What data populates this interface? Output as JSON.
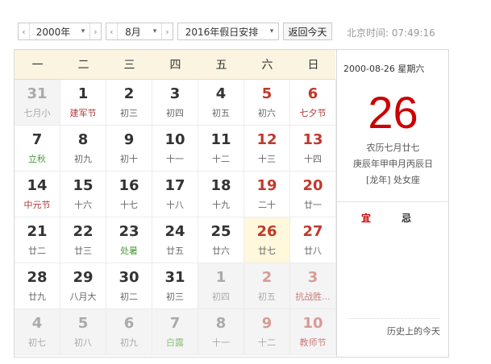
{
  "toolbar": {
    "year_label": "2000年",
    "month_label": "8月",
    "holiday_label": "2016年假日安排",
    "today_button": "返回今天",
    "time_text": "北京时间: 07:49:16"
  },
  "weekdays": [
    "一",
    "二",
    "三",
    "四",
    "五",
    "六",
    "日"
  ],
  "days": [
    {
      "n": "31",
      "l": "七月小",
      "other": true,
      "we": false,
      "c": ""
    },
    {
      "n": "1",
      "l": "建军节",
      "other": false,
      "we": false,
      "c": "hol"
    },
    {
      "n": "2",
      "l": "初三",
      "other": false,
      "we": false,
      "c": ""
    },
    {
      "n": "3",
      "l": "初四",
      "other": false,
      "we": false,
      "c": ""
    },
    {
      "n": "4",
      "l": "初五",
      "other": false,
      "we": false,
      "c": ""
    },
    {
      "n": "5",
      "l": "初六",
      "other": false,
      "we": true,
      "c": ""
    },
    {
      "n": "6",
      "l": "七夕节",
      "other": false,
      "we": true,
      "c": "hol"
    },
    {
      "n": "7",
      "l": "立秋",
      "other": false,
      "we": false,
      "c": "term"
    },
    {
      "n": "8",
      "l": "初九",
      "other": false,
      "we": false,
      "c": ""
    },
    {
      "n": "9",
      "l": "初十",
      "other": false,
      "we": false,
      "c": ""
    },
    {
      "n": "10",
      "l": "十一",
      "other": false,
      "we": false,
      "c": ""
    },
    {
      "n": "11",
      "l": "十二",
      "other": false,
      "we": false,
      "c": ""
    },
    {
      "n": "12",
      "l": "十三",
      "other": false,
      "we": true,
      "c": ""
    },
    {
      "n": "13",
      "l": "十四",
      "other": false,
      "we": true,
      "c": ""
    },
    {
      "n": "14",
      "l": "中元节",
      "other": false,
      "we": false,
      "c": "hol"
    },
    {
      "n": "15",
      "l": "十六",
      "other": false,
      "we": false,
      "c": ""
    },
    {
      "n": "16",
      "l": "十七",
      "other": false,
      "we": false,
      "c": ""
    },
    {
      "n": "17",
      "l": "十八",
      "other": false,
      "we": false,
      "c": ""
    },
    {
      "n": "18",
      "l": "十九",
      "other": false,
      "we": false,
      "c": ""
    },
    {
      "n": "19",
      "l": "二十",
      "other": false,
      "we": true,
      "c": ""
    },
    {
      "n": "20",
      "l": "廿一",
      "other": false,
      "we": true,
      "c": ""
    },
    {
      "n": "21",
      "l": "廿二",
      "other": false,
      "we": false,
      "c": ""
    },
    {
      "n": "22",
      "l": "廿三",
      "other": false,
      "we": false,
      "c": ""
    },
    {
      "n": "23",
      "l": "处暑",
      "other": false,
      "we": false,
      "c": "term"
    },
    {
      "n": "24",
      "l": "廿五",
      "other": false,
      "we": false,
      "c": ""
    },
    {
      "n": "25",
      "l": "廿六",
      "other": false,
      "we": false,
      "c": ""
    },
    {
      "n": "26",
      "l": "廿七",
      "other": false,
      "we": true,
      "c": "",
      "sel": true
    },
    {
      "n": "27",
      "l": "廿八",
      "other": false,
      "we": true,
      "c": ""
    },
    {
      "n": "28",
      "l": "廿九",
      "other": false,
      "we": false,
      "c": ""
    },
    {
      "n": "29",
      "l": "八月大",
      "other": false,
      "we": false,
      "c": ""
    },
    {
      "n": "30",
      "l": "初二",
      "other": false,
      "we": false,
      "c": ""
    },
    {
      "n": "31",
      "l": "初三",
      "other": false,
      "we": false,
      "c": ""
    },
    {
      "n": "1",
      "l": "初四",
      "other": true,
      "we": false,
      "c": ""
    },
    {
      "n": "2",
      "l": "初五",
      "other": true,
      "we": true,
      "c": ""
    },
    {
      "n": "3",
      "l": "抗战胜...",
      "other": true,
      "we": true,
      "c": "hol"
    },
    {
      "n": "4",
      "l": "初七",
      "other": true,
      "we": false,
      "c": ""
    },
    {
      "n": "5",
      "l": "初八",
      "other": true,
      "we": false,
      "c": ""
    },
    {
      "n": "6",
      "l": "初九",
      "other": true,
      "we": false,
      "c": ""
    },
    {
      "n": "7",
      "l": "白露",
      "other": true,
      "we": false,
      "c": "term"
    },
    {
      "n": "8",
      "l": "十一",
      "other": true,
      "we": false,
      "c": ""
    },
    {
      "n": "9",
      "l": "十二",
      "other": true,
      "we": true,
      "c": ""
    },
    {
      "n": "10",
      "l": "教师节",
      "other": true,
      "we": true,
      "c": "hol"
    }
  ],
  "side": {
    "date_line": "2000-08-26  星期六",
    "big_day": "26",
    "lunar": "农历七月廿七",
    "ganzhi": "庚辰年甲申月丙辰日",
    "zodiac": "[龙年]  处女座",
    "yi": "宜",
    "ji": "忌",
    "history_link": "历史上的今天"
  }
}
